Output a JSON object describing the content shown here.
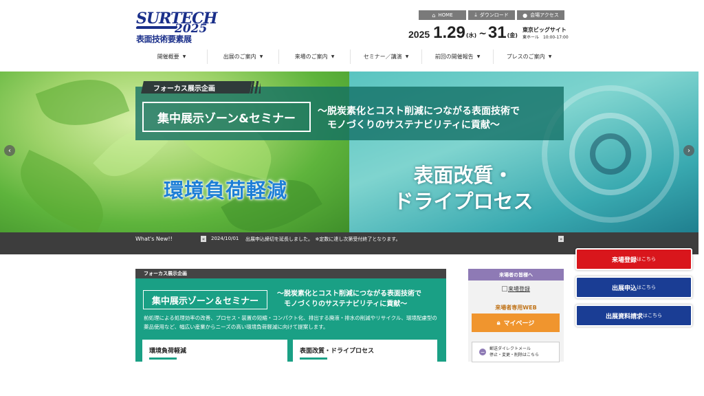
{
  "logo": {
    "line1": "SURTECH",
    "line2": "2025",
    "line3": "表面技術要素展"
  },
  "toplinks": {
    "home": "HOME",
    "download": "ダウンロード",
    "access": "会場アクセス"
  },
  "dates": {
    "year": "2025",
    "start": "1.29",
    "start_dow": "(水)",
    "tilde": "~",
    "end": "31",
    "end_dow": "(金)",
    "venue": "東京ビッグサイト",
    "venue_sub": "東ホール　10:00-17:00"
  },
  "nav": {
    "items": [
      "開催概要",
      "出展のご案内",
      "来場のご案内",
      "セミナー／講演",
      "前回の開催報告",
      "プレスのご案内"
    ]
  },
  "hero": {
    "tag": "フォーカス展示企画",
    "zone": "集中展示ゾーン&セミナー",
    "desc_line1": "～脱炭素化とコスト削減につながる表面技術で",
    "desc_line2": "モノづくりのサステナビリティに貢献～",
    "label_left": "環境負荷軽減",
    "label_right_1": "表面改質・",
    "label_right_2": "ドライプロセス"
  },
  "news": {
    "title": "What's New!!",
    "date": "2024/10/01",
    "text": "出展申込締切を延長しました。　※定数に達し次第受付終了となります。"
  },
  "feature": {
    "head": "フォーカス展示企画",
    "zone": "集中展示ゾーン＆セミナー",
    "desc_line1": "～脱炭素化とコスト削減につながる表面技術で",
    "desc_line2": "モノづくりのサステナビリティに貢献～",
    "body": "前処理による処理効率の改善、プロセス・装置の短縮・コンパクト化、排出する廃液・排水の削減やリサイクル、環境配慮型の薬品使用など、幅広い産業からニーズの高い環境負荷軽減に向けて提案します。",
    "card1": "環境負荷軽減",
    "card2": "表面改質・ドライプロセス"
  },
  "visitor": {
    "head": "来場者の皆様へ",
    "register_alt": "来場登録",
    "web_label": "来場者専用WEB",
    "mypage": "マイページ",
    "mail_line1": "郵送ダイレクトメール",
    "mail_line2": "停止・変更・削除はこちら"
  },
  "cta": {
    "visit_main": "来場登録",
    "exhibit_main": "出展申込",
    "docs_main": "出展資料請求",
    "suffix": "はこちら"
  },
  "colors": {
    "brand_blue": "#1a2f8a",
    "cta_red": "#d9161c",
    "cta_blue": "#1a3d94",
    "feature_green": "#1aa085",
    "visitor_purple": "#8e7ab5",
    "mypage_orange": "#f0952e"
  }
}
